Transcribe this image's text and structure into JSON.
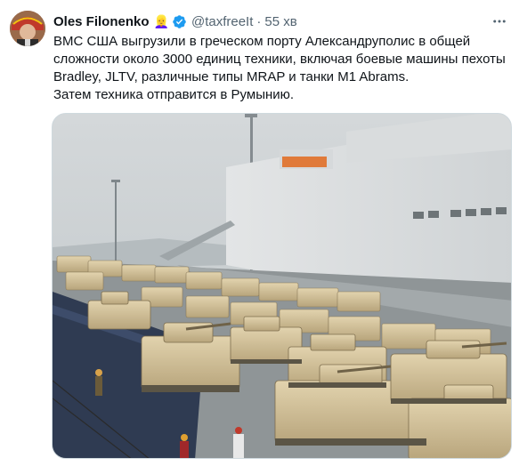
{
  "tweet": {
    "author_name": "Oles Filonenko",
    "author_emoji": "👱‍♀️",
    "handle": "@taxfreeIt",
    "separator": "·",
    "time": "55 хв",
    "text_lines": [
      "ВМС США выгрузили в греческом порту Александруполис в общей",
      "сложности около 3000 единиц техники, включая боевые машины пехоты",
      "Bradley, JLTV, различные типы MRAP и танки M1 Abrams.",
      "Затем техника отправится в Румынию."
    ]
  },
  "icons": {
    "avatar": "avatar-photo",
    "verified": "verified-badge-icon",
    "more": "more-options-icon"
  },
  "colors": {
    "verified_blue": "#1d9bf0",
    "secondary_text": "#536471",
    "primary_text": "#0f1419"
  }
}
